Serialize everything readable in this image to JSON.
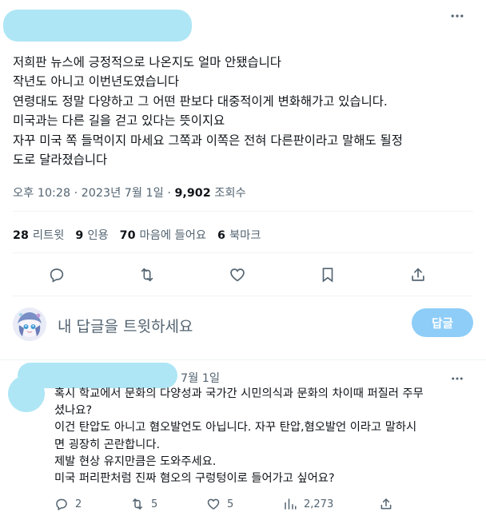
{
  "tweet": {
    "body_lines": [
      "저희판 뉴스에 긍정적으로 나온지도 얼마 안됐습니다",
      "작년도 아니고 이번년도였습니다",
      "연령대도 정말 다양하고 그 어떤 판보다 대중적이게 변화해가고 있습니다.",
      "미국과는 다른 길을 걷고 있다는 뜻이지요",
      "자꾸 미국 쪽 들먹이지 마세요 그쪽과 이쪽은 전혀 다른판이라고 말해도 될정",
      "도로 달라졌습니다"
    ],
    "timestamp": "오후 10:28 · 2023년 7월 1일 · ",
    "views_count": "9,902",
    "views_label": " 조회수"
  },
  "stats": {
    "retweets_count": "28",
    "retweets_label": "리트윗",
    "quotes_count": "9",
    "quotes_label": "인용",
    "likes_count": "70",
    "likes_label": "마음에 들어요",
    "bookmarks_count": "6",
    "bookmarks_label": "북마크"
  },
  "compose": {
    "placeholder": "내 답글을 트윗하세요",
    "button_label": "답글"
  },
  "comment": {
    "time": "7월 1일",
    "body_lines": [
      "혹시 학교에서 문화의 다양성과 국가간 시민의식과 문화의 차이때 퍼질러 주무",
      "셨나요?",
      "이건 탄압도 아니고 혐오발언도 아닙니다. 자꾸 탄압,혐오발언 이라고 말하시",
      "면 굉장히 곤란합니다.",
      "제발 현상 유지만큼은 도와주세요.",
      "미국 퍼리판처럼 진짜 혐오의 구렁텅이로 들어가고 싶어요?"
    ],
    "replies": "2",
    "retweets": "5",
    "likes": "5",
    "views": "2,273"
  },
  "icons": {
    "more": "more-icon",
    "reply": "reply-icon",
    "retweet": "retweet-icon",
    "like": "heart-icon",
    "bookmark": "bookmark-icon",
    "share": "share-icon",
    "views": "views-icon"
  },
  "colors": {
    "accent": "#1d9bf0",
    "reply_button_disabled": "#8ecdf8",
    "secondary_text": "#536471",
    "redaction": "#aee6f5"
  }
}
